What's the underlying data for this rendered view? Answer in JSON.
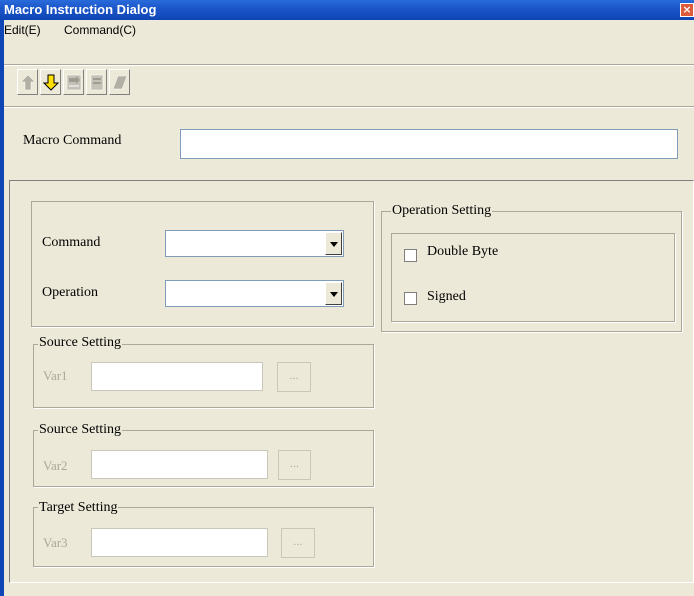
{
  "window": {
    "title": "Macro Instruction Dialog",
    "close_glyph": "×"
  },
  "menu": [
    {
      "label": "Edit(E)"
    },
    {
      "label": "Command(C)"
    }
  ],
  "toolbar": [
    {
      "icon": "arrow-up-icon",
      "enabled": false
    },
    {
      "icon": "arrow-down-icon",
      "enabled": true,
      "color": "#ffe000"
    },
    {
      "icon": "insert-icon",
      "enabled": false
    },
    {
      "icon": "delete-icon",
      "enabled": false
    },
    {
      "icon": "eraser-icon",
      "enabled": false
    }
  ],
  "macro": {
    "label": "Macro Command",
    "value": ""
  },
  "command_group": {
    "command_label": "Command",
    "command_value": "",
    "operation_label": "Operation",
    "operation_value": ""
  },
  "source1": {
    "legend": "Source Setting",
    "var_label": "Var1",
    "value": "",
    "browse_label": "..."
  },
  "source2": {
    "legend": "Source Setting",
    "var_label": "Var2",
    "value": "",
    "browse_label": "..."
  },
  "target": {
    "legend": "Target Setting",
    "var_label": "Var3",
    "value": "",
    "browse_label": "..."
  },
  "operation_setting": {
    "legend": "Operation Setting",
    "double_byte_label": "Double Byte",
    "double_byte_checked": false,
    "signed_label": "Signed",
    "signed_checked": false
  },
  "colors": {
    "titlebar": "#0f45b5",
    "dialog_bg": "#ece9d8",
    "disabled_text": "#aca899"
  }
}
